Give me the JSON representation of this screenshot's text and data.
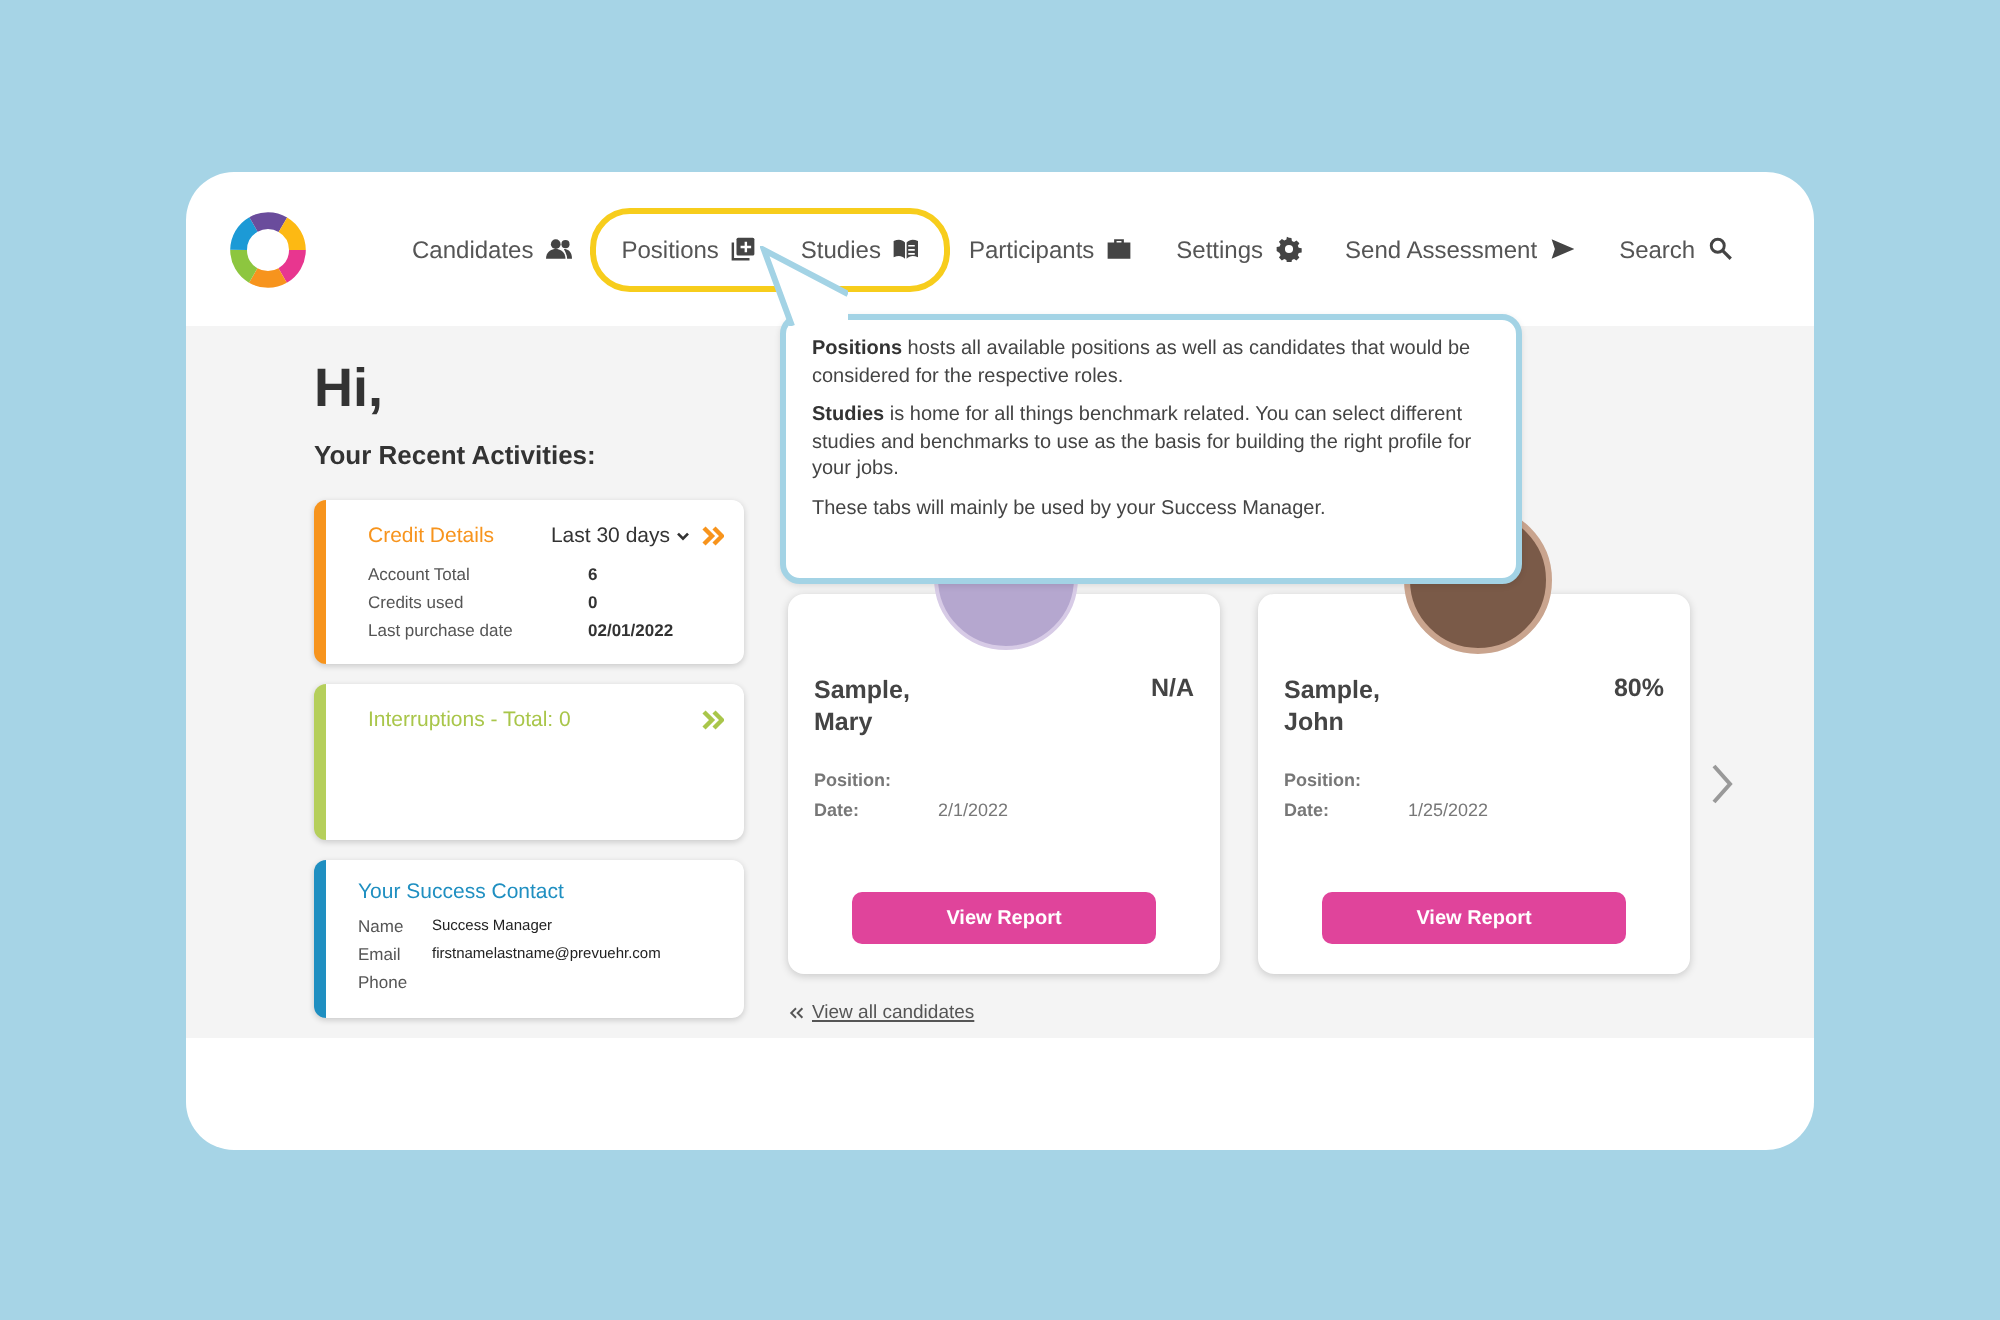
{
  "nav": {
    "items": [
      {
        "label": "Candidates",
        "highlighted": false
      },
      {
        "label": "Positions",
        "highlighted": true
      },
      {
        "label": "Studies",
        "highlighted": true
      },
      {
        "label": "Participants",
        "highlighted": false
      },
      {
        "label": "Settings",
        "highlighted": false
      },
      {
        "label": "Send Assessment",
        "highlighted": false
      },
      {
        "label": "Search",
        "highlighted": false
      }
    ]
  },
  "greeting": "Hi,",
  "activities_title": "Your Recent Activities:",
  "credit": {
    "title": "Credit Details",
    "period": "Last 30 days",
    "rows": [
      {
        "label": "Account Total",
        "value": "6"
      },
      {
        "label": "Credits used",
        "value": "0"
      },
      {
        "label": "Last purchase date",
        "value": "02/01/2022"
      }
    ]
  },
  "interruptions": {
    "title": "Interruptions - Total: 0"
  },
  "contact": {
    "title": "Your Success Contact",
    "rows": [
      {
        "label": "Name",
        "value": "Success Manager"
      },
      {
        "label": "Email",
        "value": "firstnamelastname@prevuehr.com"
      },
      {
        "label": "Phone",
        "value": ""
      }
    ]
  },
  "candidates": [
    {
      "name": "Sample, Mary",
      "score": "N/A",
      "position_label": "Position:",
      "date_label": "Date:",
      "date": "2/1/2022",
      "button": "View Report"
    },
    {
      "name": "Sample, John",
      "score": "80%",
      "position_label": "Position:",
      "date_label": "Date:",
      "date": "1/25/2022",
      "button": "View Report"
    }
  ],
  "view_all": "View all candidates",
  "tooltip": {
    "paragraphs": [
      "**Positions** hosts all available positions as well as candidates that would be considered for the respective roles.",
      "**Studies** is home for all things benchmark related. You can select different studies and benchmarks to use as the basis for building the right profile for your jobs.",
      "These tabs will mainly be used by your Success Manager."
    ]
  }
}
